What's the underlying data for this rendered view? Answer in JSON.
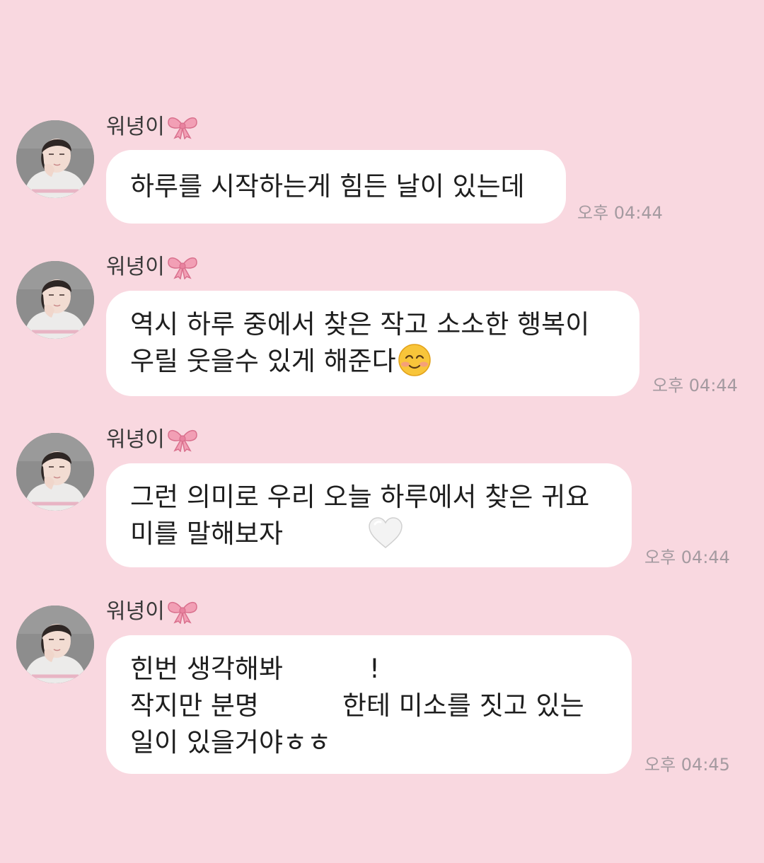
{
  "messages": [
    {
      "sender": "워녕이",
      "lines": [
        "하루를 시작하는게 힘든 날이 있는데"
      ],
      "time": "오후 04:44"
    },
    {
      "sender": "워녕이",
      "lines": [
        "역시 하루 중에서 찾은 작고 소소한 행복이",
        "우릴 웃을수 있게 해준다"
      ],
      "time": "오후 04:44"
    },
    {
      "sender": "워녕이",
      "lines": [
        "그런 의미로 우리 오늘 하루에서 찾은 귀요",
        "미를 말해보자"
      ],
      "time": "오후 04:44"
    },
    {
      "sender": "워녕이",
      "lines": [
        "힌번 생각해봐",
        "!",
        "작지만 분명",
        "한테 미소를 짓고 있는",
        "일이 있을거야ㅎㅎ"
      ],
      "time": "오후 04:45"
    }
  ],
  "icons": {
    "sender_badge": "pink-ribbon-bow-icon",
    "smile": "smiling-face-icon",
    "heart": "white-heart-icon"
  },
  "colors": {
    "background": "#f9d8e0",
    "bubble": "#ffffff",
    "timestamp": "#a49aa0",
    "bow": "#f29fb5"
  }
}
